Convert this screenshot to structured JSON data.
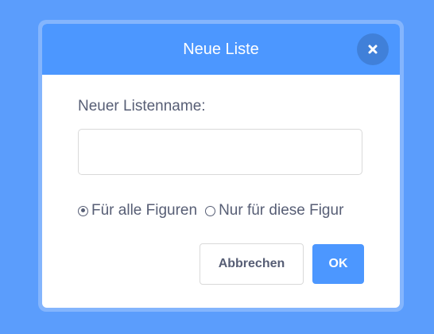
{
  "dialog": {
    "title": "Neue Liste",
    "close_icon": "close-icon"
  },
  "form": {
    "label": "Neuer Listenname:",
    "input_value": "",
    "input_placeholder": ""
  },
  "scope": {
    "options": [
      {
        "label": "Für alle Figuren",
        "checked": true
      },
      {
        "label": "Nur für diese Figur",
        "checked": false
      }
    ]
  },
  "buttons": {
    "cancel_label": "Abbrechen",
    "ok_label": "OK"
  },
  "colors": {
    "backdrop": "#5b9dfc",
    "header": "#4c97ff",
    "text": "#575e75",
    "primary": "#4c97ff"
  }
}
